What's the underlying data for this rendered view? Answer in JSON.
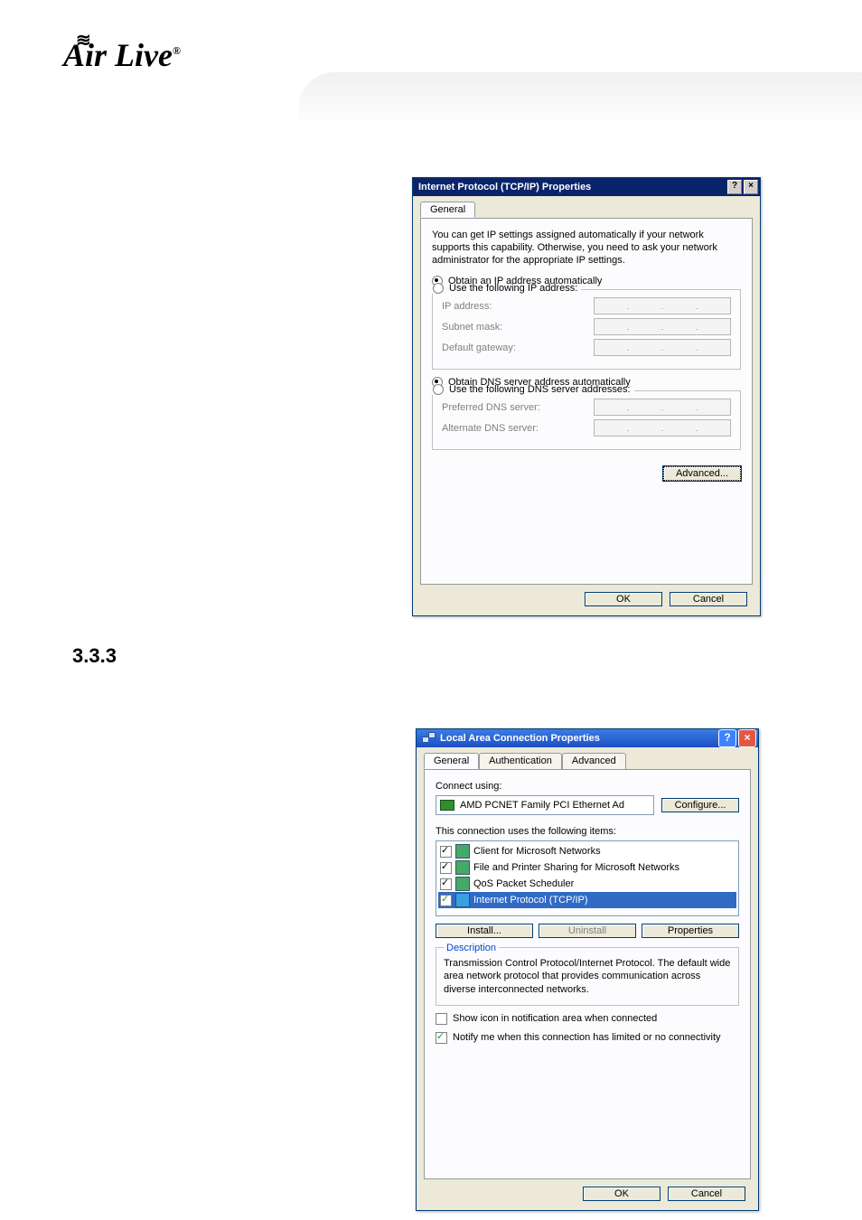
{
  "brand": "Air Live",
  "section_number": "3.3.3",
  "dlg1": {
    "title": "Internet Protocol (TCP/IP) Properties",
    "help_btn": "?",
    "close_btn": "×",
    "tab_general": "General",
    "intro": "You can get IP settings assigned automatically if your network supports this capability. Otherwise, you need to ask your network administrator for the appropriate IP settings.",
    "radio_auto_ip": "Obtain an IP address automatically",
    "radio_use_ip": "Use the following IP address:",
    "label_ip": "IP address:",
    "label_subnet": "Subnet mask:",
    "label_gateway": "Default gateway:",
    "radio_auto_dns": "Obtain DNS server address automatically",
    "radio_use_dns": "Use the following DNS server addresses:",
    "label_pref_dns": "Preferred DNS server:",
    "label_alt_dns": "Alternate DNS server:",
    "btn_advanced": "Advanced...",
    "btn_ok": "OK",
    "btn_cancel": "Cancel"
  },
  "dlg2": {
    "title": "Local Area Connection Properties",
    "help_btn": "?",
    "close_btn": "×",
    "tab_general": "General",
    "tab_auth": "Authentication",
    "tab_adv": "Advanced",
    "connect_using": "Connect using:",
    "adapter": "AMD PCNET Family PCI Ethernet Ad",
    "btn_configure": "Configure...",
    "items_label": "This connection uses the following items:",
    "items": [
      "Client for Microsoft Networks",
      "File and Printer Sharing for Microsoft Networks",
      "QoS Packet Scheduler",
      "Internet Protocol (TCP/IP)"
    ],
    "btn_install": "Install...",
    "btn_uninstall": "Uninstall",
    "btn_properties": "Properties",
    "desc_legend": "Description",
    "desc_text": "Transmission Control Protocol/Internet Protocol. The default wide area network protocol that provides communication across diverse interconnected networks.",
    "chk_show_icon": "Show icon in notification area when connected",
    "chk_notify": "Notify me when this connection has limited or no connectivity",
    "btn_ok": "OK",
    "btn_cancel": "Cancel"
  }
}
